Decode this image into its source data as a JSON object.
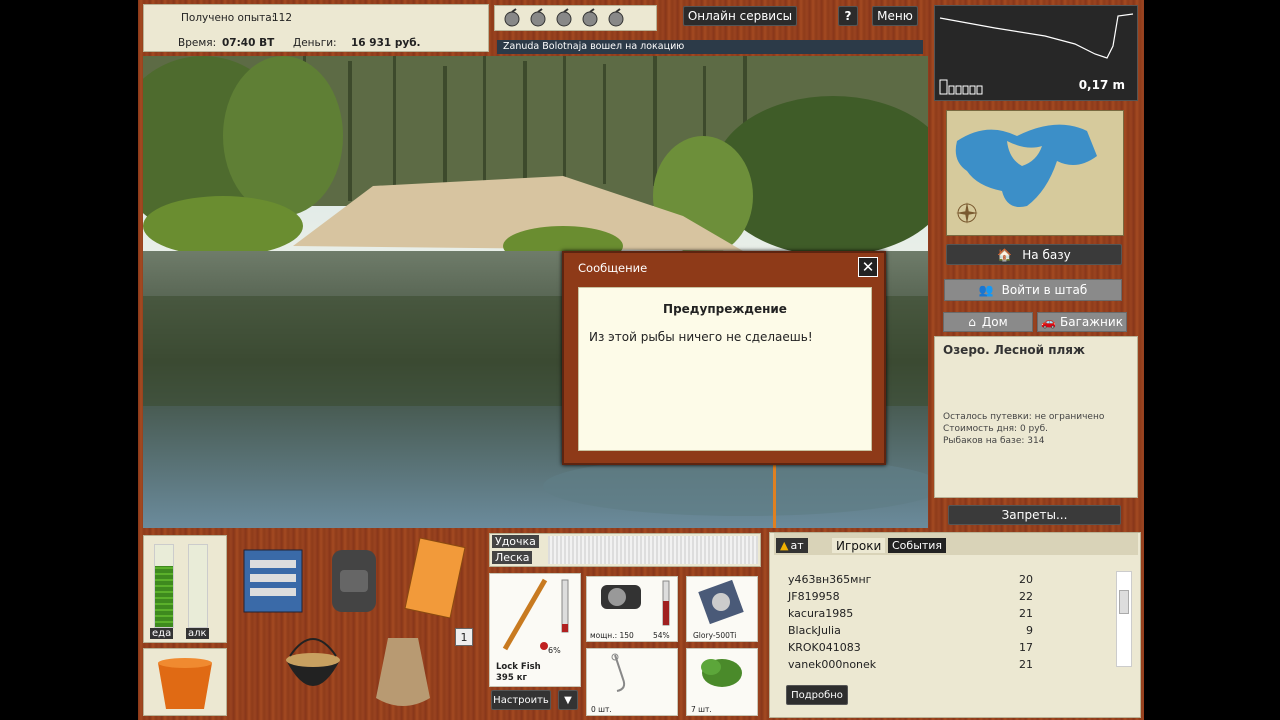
{
  "top": {
    "exp_label": "Получено опыта:",
    "exp_value": "112",
    "time_label": "Время:",
    "time_value": "07:40 ВТ",
    "money_label": "Деньги:",
    "money_value": "16 931 руб.",
    "online_services": "Онлайн сервисы",
    "help": "?",
    "menu": "Меню",
    "notice": "Zanuda Bolotnaja вошел на локацию"
  },
  "depth": {
    "value": "0,17 m"
  },
  "right": {
    "to_base": "На базу",
    "enter_hq": "Войти в штаб",
    "home": "Дом",
    "trunk": "Багажник",
    "location_title": "Озеро. Лесной пляж",
    "permit_left": "Осталось путевки: не ограничено",
    "day_cost": "Стоимость дня: 0 руб.",
    "fishers": "Рыбаков на базе: 314",
    "bans": "Запреты..."
  },
  "dialog": {
    "title": "Сообщение",
    "close": "✕",
    "heading": "Предупреждение",
    "text": "Из этой рыбы ничего не сделаешь!"
  },
  "bottom": {
    "food_label": "еда",
    "alc_label": "алк",
    "food_level": 0.75,
    "alc_level": 0.0,
    "slot_num": "1",
    "rod_label": "Удочка",
    "line_label": "Леска",
    "rod_name": "Lock Fish",
    "rod_weight": "395 кг",
    "rod_percent": "6%",
    "reel_power": "мощн.: 150",
    "reel_percent": "54%",
    "line_name": "Glory-500Ti",
    "hooks_count": "0 шт.",
    "bait_count": "7 шт.",
    "configure": "Настроить",
    "dropdown": "▼"
  },
  "chat": {
    "tab_chat": "ат",
    "tab_players": "Игроки",
    "tab_events": "События",
    "players": [
      {
        "name": "у463вн365мнг",
        "level": "20"
      },
      {
        "name": "JF819958",
        "level": "22"
      },
      {
        "name": "kacura1985",
        "level": "21"
      },
      {
        "name": "BlackJulia",
        "level": "9"
      },
      {
        "name": "KROK041083",
        "level": "17"
      },
      {
        "name": "vanek000nonek",
        "level": "21"
      }
    ],
    "details": "Подробно"
  },
  "colors": {
    "wood": "#9a4320",
    "panel": "#ece8d2",
    "water": "#2d3f45"
  }
}
